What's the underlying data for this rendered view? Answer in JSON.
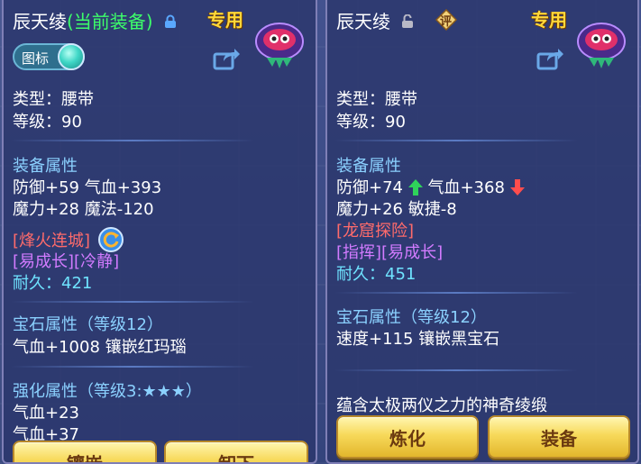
{
  "left": {
    "name": "辰天绫",
    "current_tag": "(当前装备)",
    "exclusive": "专用",
    "icon_toggle_label": "图标",
    "type_line": "类型：腰带",
    "level_line": "等级：90",
    "attr_header": "装备属性",
    "attr_line1": "防御+59 气血+393",
    "attr_line2": "魔力+28 魔法-120",
    "special_skill": "[烽火连城]",
    "special_effects": "[易成长][冷静]",
    "durability_label": "耐久：",
    "durability_value": "421",
    "gem_header": "宝石属性（等级12）",
    "gem_line": "气血+1008 镶嵌红玛瑙",
    "enhance_header": "强化属性（等级3:★★★）",
    "enhance_line1": "气血+23",
    "enhance_line2": "气血+37",
    "btn_inlay": "镶嵌",
    "btn_unequip": "卸下"
  },
  "right": {
    "name": "辰天绫",
    "ping_badge": "评",
    "exclusive": "专用",
    "type_line": "类型：腰带",
    "level_line": "等级：90",
    "attr_header": "装备属性",
    "attr_def": "防御+74",
    "attr_hp": "气血+368",
    "attr_line2": "魔力+26 敏捷-8",
    "special_skill": "[龙窟探险]",
    "special_effects": "[指挥][易成长]",
    "durability_label": "耐久：",
    "durability_value": "451",
    "gem_header": "宝石属性（等级12）",
    "gem_line": "速度+115 镶嵌黑宝石",
    "description": "蕴含太极两仪之力的神奇绫缎",
    "btn_refine": "炼化",
    "btn_equip": "装备"
  },
  "colors": {
    "title_highlight": "#3dff6a",
    "section": "#8bd1ff",
    "skill": "#ff6b6b",
    "effect": "#d27bff",
    "durability": "#6fe3ff",
    "exclusive": "#ffd73a",
    "button": "#f7d95a"
  },
  "icons": [
    "lock-icon",
    "unlock-icon",
    "avatar-icon",
    "share-icon",
    "refresh-icon",
    "up-arrow-icon",
    "down-arrow-icon",
    "ping-badge-icon"
  ]
}
